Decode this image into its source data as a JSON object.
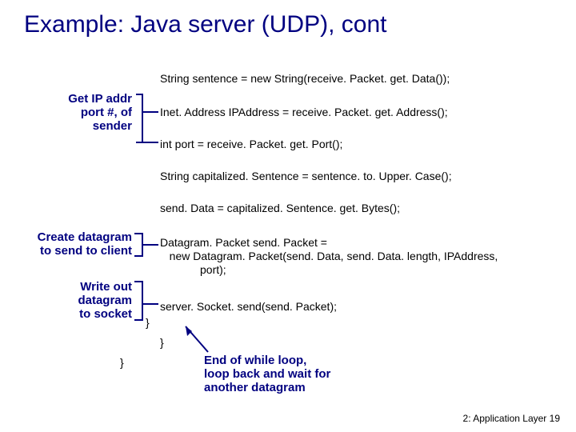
{
  "title": "Example: Java server (UDP), cont",
  "code": {
    "line1": "String sentence = new String(receive. Packet. get. Data());",
    "line2": "Inet. Address IPAddress = receive. Packet. get. Address();",
    "line3": "int port = receive. Packet. get. Port();",
    "line4": "String capitalized. Sentence = sentence. to. Upper. Case();",
    "line5": "send. Data = capitalized. Sentence. get. Bytes();",
    "line6a": "Datagram. Packet send. Packet =",
    "line6b": "   new Datagram. Packet(send. Data, send. Data. length, IPAddress,",
    "line6c": "port);",
    "line7": "server. Socket. send(send. Packet);",
    "brace1": "}",
    "brace2": "}",
    "brace3": "}"
  },
  "annotations": {
    "getip": "Get IP addr\nport #, of\nsender",
    "create": "Create datagram\nto send to client",
    "write": "Write out\ndatagram\nto socket",
    "endloop": "End of while loop,\nloop back and wait for\nanother datagram"
  },
  "footer": {
    "chapter": "2: Application Layer",
    "page": "19"
  },
  "colors": {
    "accent": "#000080"
  }
}
